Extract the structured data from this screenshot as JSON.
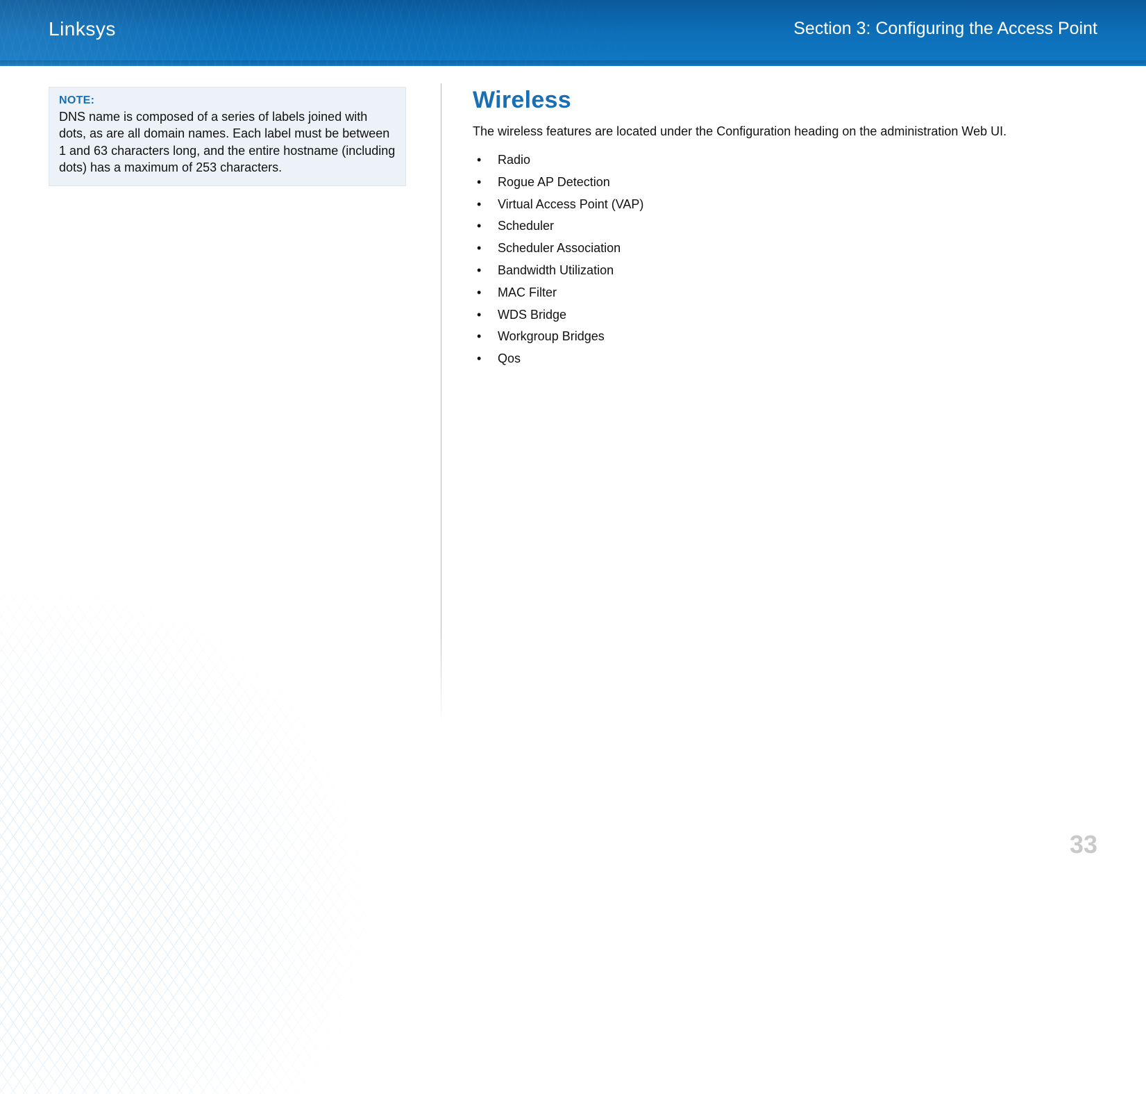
{
  "header": {
    "brand": "Linksys",
    "section": "Section 3:  Configuring the Access Point"
  },
  "left": {
    "note_label": "NOTE:",
    "note_text": "DNS name is composed of a series of labels joined with dots, as are all domain names. Each label must be between 1 and 63 characters long, and the entire hostname (including dots) has a maximum of 253 characters."
  },
  "right": {
    "heading": "Wireless",
    "intro": "The wireless features are located under the Configuration heading on the administration Web UI.",
    "items": [
      "Radio",
      "Rogue AP Detection",
      "Virtual Access Point (VAP)",
      "Scheduler",
      "Scheduler Association",
      "Bandwidth Utilization",
      "MAC Filter",
      "WDS Bridge",
      "Workgroup Bridges",
      "Qos"
    ]
  },
  "page_number": "33"
}
